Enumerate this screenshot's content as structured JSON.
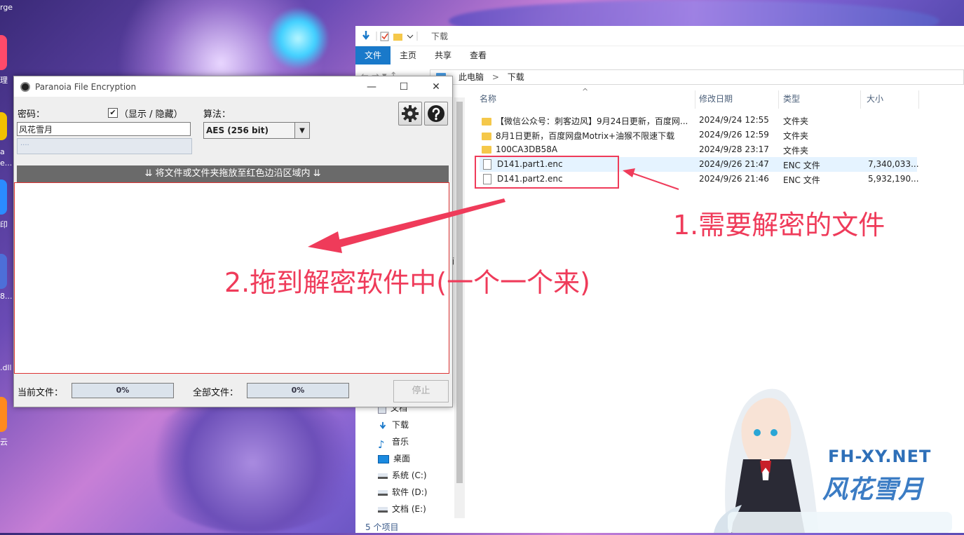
{
  "desktop": {
    "corner_text": "rge",
    "side_labels": [
      "理",
      "a",
      "e...",
      "印",
      "8...",
      ".dll",
      "云"
    ]
  },
  "pfe": {
    "title": "Paranoia File Encryption",
    "window_buttons": {
      "minimize": "—",
      "maximize": "☐",
      "close": "✕"
    },
    "password_label": "密码：",
    "show_hide_label": "（显示 / 隐藏）",
    "show_checked": true,
    "check_mark": "✔",
    "password_value": "风花雪月",
    "strength_text": "....",
    "algorithm_label": "算法：",
    "algorithm_value": "AES (256 bit)",
    "algorithm_arrow": "▼",
    "drop_text": "⇊ 将文件或文件夹拖放至红色边沿区域内 ⇊",
    "current_file_label": "当前文件：",
    "current_progress": "0%",
    "current_progress_pct": 0,
    "all_files_label": "全部文件：",
    "all_progress": "0%",
    "all_progress_pct": 0,
    "stop_label": "停止"
  },
  "explorer": {
    "title": "下载",
    "tabs": [
      {
        "label": "文件",
        "active": true
      },
      {
        "label": "主页",
        "active": false
      },
      {
        "label": "共享",
        "active": false
      },
      {
        "label": "查看",
        "active": false
      }
    ],
    "nav": "←  →  ▾  ↑",
    "breadcrumb": [
      "此电脑",
      "下载"
    ],
    "breadcrumb_sep": ">",
    "columns": {
      "name": "名称",
      "modified": "修改日期",
      "type": "类型",
      "size": "大小"
    },
    "sort_arrow": "^",
    "files": [
      {
        "name": "【微信公众号：刺客边风】9月24日更新，百度网...",
        "modified": "2024/9/24 12:55",
        "type": "文件夹",
        "size": "",
        "kind": "folder",
        "selected": false
      },
      {
        "name": "8月1日更新，百度网盘Motrix+油猴不限速下载",
        "modified": "2024/9/26 12:59",
        "type": "文件夹",
        "size": "",
        "kind": "folder",
        "selected": false
      },
      {
        "name": "100CA3DB58A",
        "modified": "2024/9/28 23:17",
        "type": "文件夹",
        "size": "",
        "kind": "folder",
        "selected": false
      },
      {
        "name": "D141.part1.enc",
        "modified": "2024/9/26 21:47",
        "type": "ENC 文件",
        "size": "7,340,033...",
        "kind": "file",
        "selected": true
      },
      {
        "name": "D141.part2.enc",
        "modified": "2024/9/26 21:46",
        "type": "ENC 文件",
        "size": "5,932,190...",
        "kind": "file",
        "selected": false
      }
    ],
    "tree": [
      {
        "label": "文档",
        "icon": "document-icon"
      },
      {
        "label": "下载",
        "icon": "download-icon"
      },
      {
        "label": "音乐",
        "icon": "music-icon"
      },
      {
        "label": "桌面",
        "icon": "desktop-icon"
      },
      {
        "label": "系统 (C:)",
        "icon": "drive-icon"
      },
      {
        "label": "软件 (D:)",
        "icon": "drive-icon"
      },
      {
        "label": "文档 (E:)",
        "icon": "drive-icon"
      }
    ],
    "status": "5 个项目",
    "partial_char": "面"
  },
  "annotations": {
    "step1": "1.需要解密的文件",
    "step2": "2.拖到解密软件中(一个一个来)"
  },
  "brand": {
    "domain": "FH-XY.NET",
    "name": "风花雪月"
  },
  "colors": {
    "annotation": "#ef3b5a",
    "ribbon_active": "#1979ca",
    "brand": "#2e6fb8"
  }
}
